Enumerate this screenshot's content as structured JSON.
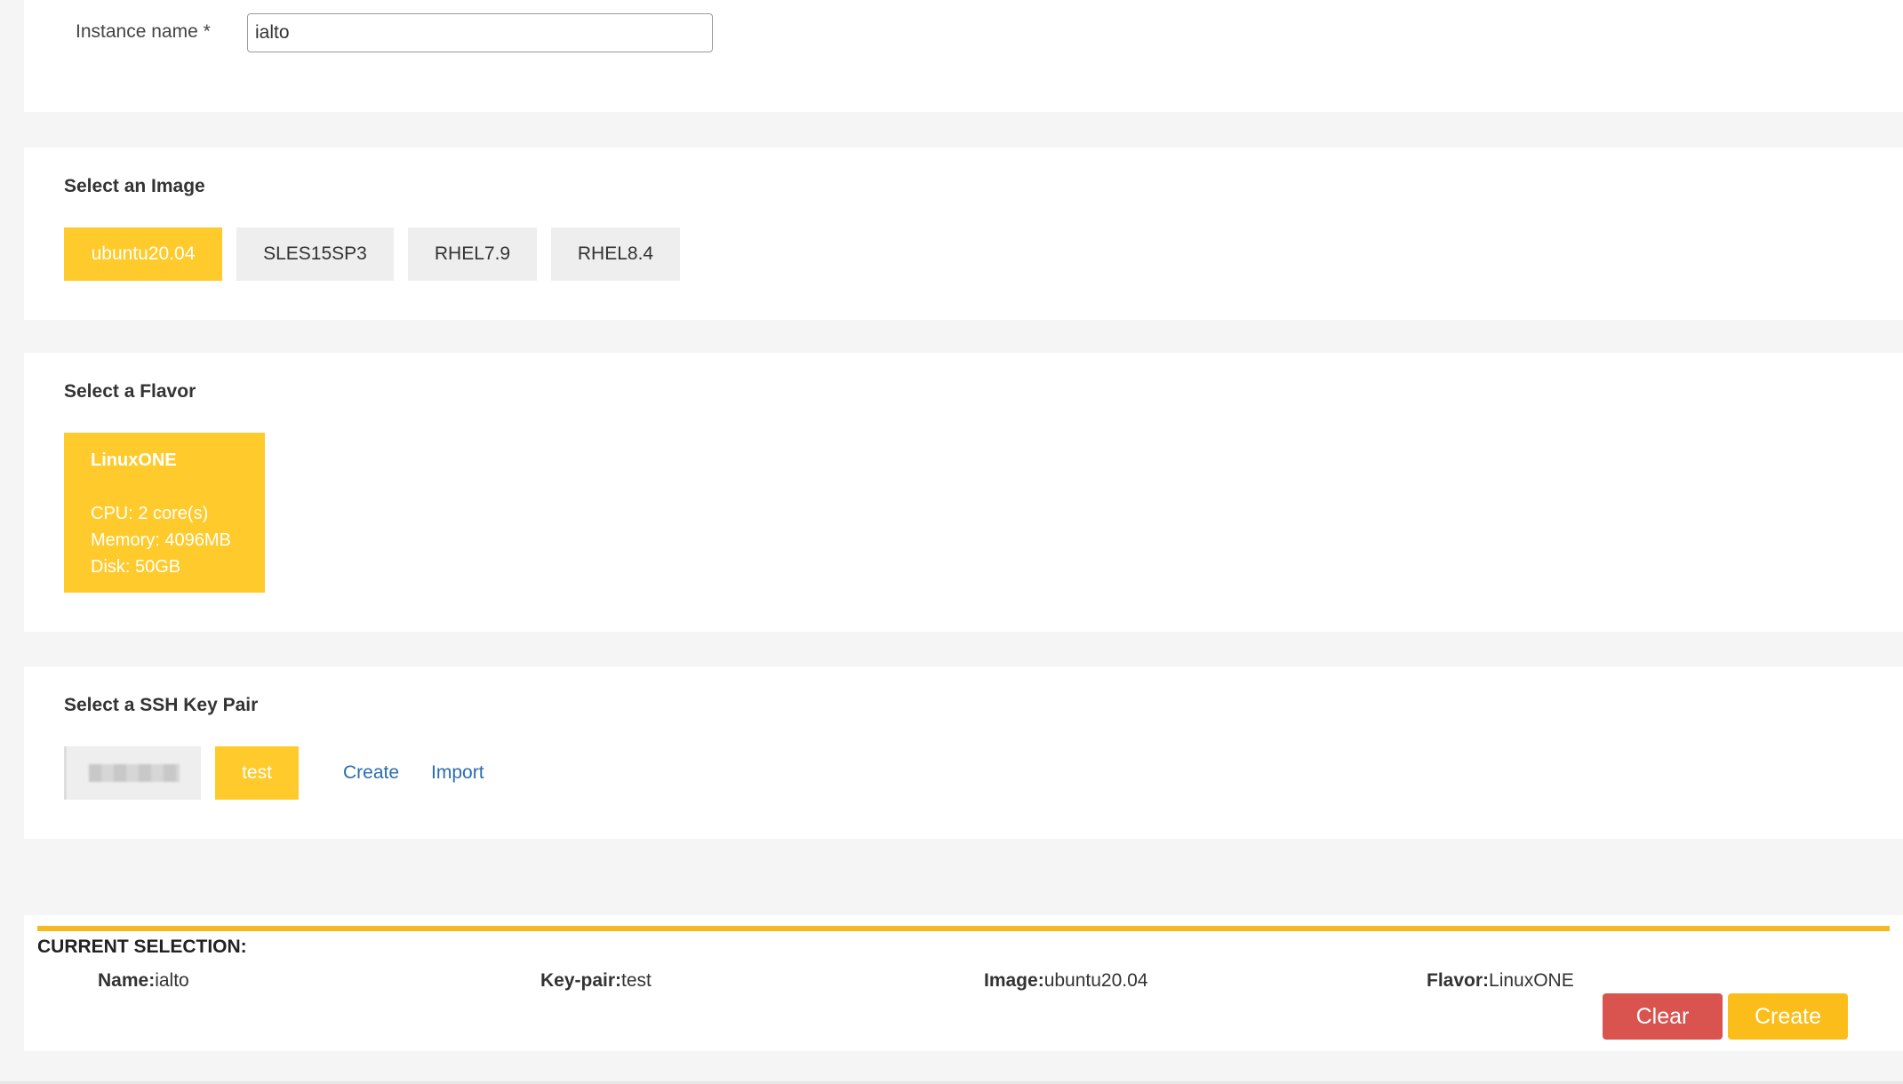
{
  "instance": {
    "label": "Instance name *",
    "value": "ialto"
  },
  "image_section": {
    "title": "Select an Image",
    "options": [
      "ubuntu20.04",
      "SLES15SP3",
      "RHEL7.9",
      "RHEL8.4"
    ],
    "selected": "ubuntu20.04"
  },
  "flavor_section": {
    "title": "Select a Flavor",
    "card": {
      "name": "LinuxONE",
      "cpu": "CPU: 2 core(s)",
      "memory": "Memory: 4096MB",
      "disk": "Disk: 50GB"
    }
  },
  "ssh_section": {
    "title": "Select a SSH Key Pair",
    "selected_key": "test",
    "create_link": "Create",
    "import_link": "Import"
  },
  "selection": {
    "title": "CURRENT SELECTION:",
    "name_label": "Name:",
    "name_value": "ialto",
    "keypair_label": "Key-pair:",
    "keypair_value": "test",
    "image_label": "Image:",
    "image_value": "ubuntu20.04",
    "flavor_label": "Flavor:",
    "flavor_value": "LinuxONE",
    "clear_label": "Clear",
    "create_label": "Create"
  },
  "colors": {
    "accent": "#ffca2c",
    "danger": "#d9534f",
    "link": "#2b6cb0"
  }
}
